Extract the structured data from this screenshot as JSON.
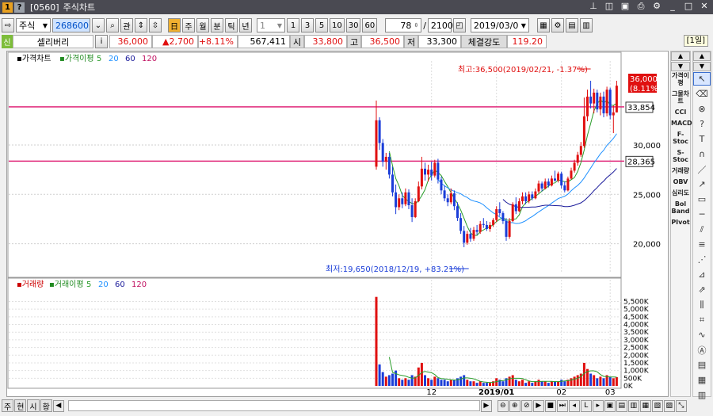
{
  "window": {
    "screen_no": "[0560]",
    "title": "주식차트"
  },
  "toolbar": {
    "market": "주식",
    "code": "268600",
    "btn_search": "⌕",
    "btn_rel": "관",
    "periods": [
      "주",
      "월",
      "분",
      "틱",
      "년"
    ],
    "interval": "1",
    "quick": [
      "1",
      "3",
      "5",
      "10",
      "30",
      "60"
    ],
    "count": "78",
    "total": "2100",
    "date": "2019/03/0"
  },
  "info": {
    "badge": "신",
    "name": "셀리버리",
    "info_btn": "i",
    "price": "36,000",
    "change": "▲2,700",
    "rate": "+8.11%",
    "volume": "567,411",
    "open_lbl": "시",
    "open": "33,800",
    "high_lbl": "고",
    "high": "36,500",
    "low_lbl": "저",
    "low": "33,300",
    "strength_lbl": "체결강도",
    "strength": "119.20",
    "period": "[1일]"
  },
  "right_panel": [
    "가격이평",
    "그물차트",
    "CCI",
    "MACD",
    "F-Stoc",
    "S-Stoc",
    "거래량",
    "OBV",
    "심리도",
    "Bol Band",
    "PIvot"
  ],
  "bottom": {
    "tabs": [
      "주",
      "현",
      "시",
      "황"
    ]
  },
  "chart_data": {
    "type": "candlestick",
    "price_legend": {
      "title": "가격차트",
      "ma_label": "가격이평",
      "periods": [
        "5",
        "20",
        "60",
        "120"
      ]
    },
    "volume_legend": {
      "title": "거래량",
      "ma_label": "거래이평",
      "periods": [
        "5",
        "20",
        "60",
        "120"
      ]
    },
    "price_axis": {
      "ticks": [
        "30,000",
        "25,000",
        "20,000"
      ],
      "tick_values": [
        30000,
        25000,
        20000
      ],
      "ylim": [
        17000,
        38500
      ]
    },
    "volume_axis": {
      "ticks": [
        "5,500K",
        "5,000K",
        "4,500K",
        "4,000K",
        "3,500K",
        "3,000K",
        "2,500K",
        "2,000K",
        "1,500K",
        "1,000K",
        "500K",
        "0K"
      ],
      "tick_values": [
        5500,
        5000,
        4500,
        4000,
        3500,
        3000,
        2500,
        2000,
        1500,
        1000,
        500,
        0
      ],
      "ylim": [
        0,
        6300
      ]
    },
    "x_labels": [
      {
        "label": "12",
        "index": 17
      },
      {
        "label": "2019/01",
        "index": 37
      },
      {
        "label": "02",
        "index": 57
      },
      {
        "label": "03",
        "index": 72
      }
    ],
    "hlines": [
      {
        "value": 33854,
        "label": "33,854"
      },
      {
        "value": 28365,
        "label": "28,365"
      }
    ],
    "current": {
      "value": 36000,
      "label": "36,000",
      "rate_label": "(8.11%)"
    },
    "high_annotation": "최고:36,500(2019/02/21, -1.37%)",
    "low_annotation": "최저:19,650(2018/12/19, +83.21%)",
    "candles": [
      {
        "o": 27800,
        "h": 34500,
        "l": 27500,
        "c": 32500,
        "v": 5800
      },
      {
        "o": 32500,
        "h": 32800,
        "l": 29500,
        "c": 30200,
        "v": 1400
      },
      {
        "o": 30200,
        "h": 30600,
        "l": 27800,
        "c": 28300,
        "v": 900
      },
      {
        "o": 28300,
        "h": 29200,
        "l": 27500,
        "c": 28800,
        "v": 600
      },
      {
        "o": 28800,
        "h": 29200,
        "l": 26600,
        "c": 27000,
        "v": 700
      },
      {
        "o": 27000,
        "h": 27800,
        "l": 24800,
        "c": 25200,
        "v": 800
      },
      {
        "o": 25200,
        "h": 26000,
        "l": 23000,
        "c": 23700,
        "v": 1000
      },
      {
        "o": 23700,
        "h": 25000,
        "l": 23400,
        "c": 24600,
        "v": 500
      },
      {
        "o": 24600,
        "h": 25200,
        "l": 23600,
        "c": 24000,
        "v": 400
      },
      {
        "o": 24000,
        "h": 25600,
        "l": 23800,
        "c": 25200,
        "v": 500
      },
      {
        "o": 25200,
        "h": 25500,
        "l": 23500,
        "c": 23900,
        "v": 400
      },
      {
        "o": 23900,
        "h": 24600,
        "l": 22200,
        "c": 22700,
        "v": 700
      },
      {
        "o": 22700,
        "h": 24600,
        "l": 22600,
        "c": 24300,
        "v": 600
      },
      {
        "o": 24300,
        "h": 26300,
        "l": 24200,
        "c": 25800,
        "v": 1200
      },
      {
        "o": 25800,
        "h": 28800,
        "l": 25500,
        "c": 27600,
        "v": 1500
      },
      {
        "o": 27600,
        "h": 28200,
        "l": 26400,
        "c": 27000,
        "v": 700
      },
      {
        "o": 27000,
        "h": 28000,
        "l": 26300,
        "c": 27500,
        "v": 500
      },
      {
        "o": 27500,
        "h": 28300,
        "l": 26400,
        "c": 26900,
        "v": 400
      },
      {
        "o": 26900,
        "h": 28500,
        "l": 26700,
        "c": 28200,
        "v": 600
      },
      {
        "o": 28200,
        "h": 28600,
        "l": 26100,
        "c": 26500,
        "v": 500
      },
      {
        "o": 26500,
        "h": 26800,
        "l": 25000,
        "c": 25400,
        "v": 400
      },
      {
        "o": 25400,
        "h": 25900,
        "l": 24300,
        "c": 24600,
        "v": 400
      },
      {
        "o": 24600,
        "h": 25000,
        "l": 23800,
        "c": 24200,
        "v": 300
      },
      {
        "o": 24200,
        "h": 25600,
        "l": 24000,
        "c": 25100,
        "v": 400
      },
      {
        "o": 25100,
        "h": 25400,
        "l": 23400,
        "c": 23800,
        "v": 400
      },
      {
        "o": 23800,
        "h": 24200,
        "l": 22300,
        "c": 22600,
        "v": 500
      },
      {
        "o": 22600,
        "h": 23100,
        "l": 21000,
        "c": 21300,
        "v": 600
      },
      {
        "o": 21300,
        "h": 21800,
        "l": 19650,
        "c": 20100,
        "v": 700
      },
      {
        "o": 20100,
        "h": 21300,
        "l": 19900,
        "c": 21000,
        "v": 400
      },
      {
        "o": 21000,
        "h": 21600,
        "l": 20200,
        "c": 20500,
        "v": 300
      },
      {
        "o": 20500,
        "h": 21700,
        "l": 20300,
        "c": 21400,
        "v": 300
      },
      {
        "o": 21400,
        "h": 21900,
        "l": 20900,
        "c": 21200,
        "v": 200
      },
      {
        "o": 21200,
        "h": 22300,
        "l": 21000,
        "c": 22000,
        "v": 300
      },
      {
        "o": 22000,
        "h": 22600,
        "l": 21600,
        "c": 21900,
        "v": 200
      },
      {
        "o": 21900,
        "h": 22300,
        "l": 21300,
        "c": 21500,
        "v": 200
      },
      {
        "o": 21500,
        "h": 22200,
        "l": 21200,
        "c": 21900,
        "v": 200
      },
      {
        "o": 21900,
        "h": 22600,
        "l": 21700,
        "c": 22400,
        "v": 300
      },
      {
        "o": 22400,
        "h": 23800,
        "l": 22200,
        "c": 23500,
        "v": 500
      },
      {
        "o": 23500,
        "h": 24200,
        "l": 22800,
        "c": 23100,
        "v": 400
      },
      {
        "o": 23100,
        "h": 23300,
        "l": 22000,
        "c": 22300,
        "v": 300
      },
      {
        "o": 22300,
        "h": 22600,
        "l": 20300,
        "c": 20700,
        "v": 500
      },
      {
        "o": 20700,
        "h": 22600,
        "l": 20500,
        "c": 22300,
        "v": 600
      },
      {
        "o": 22300,
        "h": 24200,
        "l": 22200,
        "c": 24000,
        "v": 700
      },
      {
        "o": 24000,
        "h": 24700,
        "l": 23000,
        "c": 23300,
        "v": 400
      },
      {
        "o": 23300,
        "h": 24600,
        "l": 23200,
        "c": 24300,
        "v": 300
      },
      {
        "o": 24300,
        "h": 25200,
        "l": 24000,
        "c": 24800,
        "v": 400
      },
      {
        "o": 24800,
        "h": 25200,
        "l": 24000,
        "c": 24300,
        "v": 200
      },
      {
        "o": 24300,
        "h": 25300,
        "l": 24100,
        "c": 25000,
        "v": 300
      },
      {
        "o": 25000,
        "h": 25300,
        "l": 24400,
        "c": 24600,
        "v": 200
      },
      {
        "o": 24600,
        "h": 25600,
        "l": 24500,
        "c": 25300,
        "v": 300
      },
      {
        "o": 25300,
        "h": 26400,
        "l": 25100,
        "c": 26100,
        "v": 400
      },
      {
        "o": 26100,
        "h": 26300,
        "l": 25300,
        "c": 25600,
        "v": 300
      },
      {
        "o": 25600,
        "h": 26600,
        "l": 25500,
        "c": 26300,
        "v": 300
      },
      {
        "o": 26300,
        "h": 26600,
        "l": 25700,
        "c": 25900,
        "v": 200
      },
      {
        "o": 25900,
        "h": 26900,
        "l": 25800,
        "c": 26600,
        "v": 300
      },
      {
        "o": 26600,
        "h": 27400,
        "l": 26300,
        "c": 26400,
        "v": 300
      },
      {
        "o": 26400,
        "h": 27300,
        "l": 26200,
        "c": 27100,
        "v": 300
      },
      {
        "o": 27100,
        "h": 27300,
        "l": 25600,
        "c": 25900,
        "v": 400
      },
      {
        "o": 25900,
        "h": 26300,
        "l": 25200,
        "c": 25400,
        "v": 300
      },
      {
        "o": 25400,
        "h": 26800,
        "l": 25300,
        "c": 26600,
        "v": 400
      },
      {
        "o": 26600,
        "h": 27700,
        "l": 26500,
        "c": 27400,
        "v": 500
      },
      {
        "o": 27400,
        "h": 28500,
        "l": 27200,
        "c": 28200,
        "v": 600
      },
      {
        "o": 28200,
        "h": 29300,
        "l": 27900,
        "c": 29000,
        "v": 700
      },
      {
        "o": 29000,
        "h": 30300,
        "l": 28800,
        "c": 29900,
        "v": 800
      },
      {
        "o": 29900,
        "h": 34800,
        "l": 29700,
        "c": 32900,
        "v": 1500
      },
      {
        "o": 32900,
        "h": 35600,
        "l": 32400,
        "c": 34900,
        "v": 1100
      },
      {
        "o": 34900,
        "h": 36500,
        "l": 33700,
        "c": 34200,
        "v": 800
      },
      {
        "o": 34200,
        "h": 35700,
        "l": 33200,
        "c": 35300,
        "v": 700
      },
      {
        "o": 35300,
        "h": 35600,
        "l": 33300,
        "c": 33600,
        "v": 500
      },
      {
        "o": 33600,
        "h": 35300,
        "l": 33000,
        "c": 34900,
        "v": 600
      },
      {
        "o": 34900,
        "h": 35400,
        "l": 32800,
        "c": 33200,
        "v": 500
      },
      {
        "o": 33200,
        "h": 35900,
        "l": 32900,
        "c": 35600,
        "v": 700
      },
      {
        "o": 35600,
        "h": 35800,
        "l": 32600,
        "c": 33000,
        "v": 600
      },
      {
        "o": 33000,
        "h": 34000,
        "l": 31200,
        "c": 33300,
        "v": 500
      },
      {
        "o": 33300,
        "h": 36500,
        "l": 33300,
        "c": 36000,
        "v": 567
      }
    ]
  }
}
